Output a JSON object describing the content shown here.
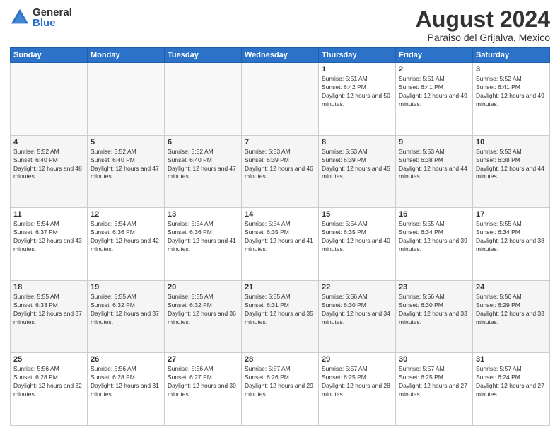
{
  "header": {
    "logo_general": "General",
    "logo_blue": "Blue",
    "month_year": "August 2024",
    "location": "Paraiso del Grijalva, Mexico"
  },
  "days_of_week": [
    "Sunday",
    "Monday",
    "Tuesday",
    "Wednesday",
    "Thursday",
    "Friday",
    "Saturday"
  ],
  "weeks": [
    [
      {
        "day": "",
        "sunrise": "",
        "sunset": "",
        "daylight": "",
        "empty": true
      },
      {
        "day": "",
        "sunrise": "",
        "sunset": "",
        "daylight": "",
        "empty": true
      },
      {
        "day": "",
        "sunrise": "",
        "sunset": "",
        "daylight": "",
        "empty": true
      },
      {
        "day": "",
        "sunrise": "",
        "sunset": "",
        "daylight": "",
        "empty": true
      },
      {
        "day": "1",
        "sunrise": "Sunrise: 5:51 AM",
        "sunset": "Sunset: 6:42 PM",
        "daylight": "Daylight: 12 hours and 50 minutes."
      },
      {
        "day": "2",
        "sunrise": "Sunrise: 5:51 AM",
        "sunset": "Sunset: 6:41 PM",
        "daylight": "Daylight: 12 hours and 49 minutes."
      },
      {
        "day": "3",
        "sunrise": "Sunrise: 5:52 AM",
        "sunset": "Sunset: 6:41 PM",
        "daylight": "Daylight: 12 hours and 49 minutes."
      }
    ],
    [
      {
        "day": "4",
        "sunrise": "Sunrise: 5:52 AM",
        "sunset": "Sunset: 6:40 PM",
        "daylight": "Daylight: 12 hours and 48 minutes."
      },
      {
        "day": "5",
        "sunrise": "Sunrise: 5:52 AM",
        "sunset": "Sunset: 6:40 PM",
        "daylight": "Daylight: 12 hours and 47 minutes."
      },
      {
        "day": "6",
        "sunrise": "Sunrise: 5:52 AM",
        "sunset": "Sunset: 6:40 PM",
        "daylight": "Daylight: 12 hours and 47 minutes."
      },
      {
        "day": "7",
        "sunrise": "Sunrise: 5:53 AM",
        "sunset": "Sunset: 6:39 PM",
        "daylight": "Daylight: 12 hours and 46 minutes."
      },
      {
        "day": "8",
        "sunrise": "Sunrise: 5:53 AM",
        "sunset": "Sunset: 6:39 PM",
        "daylight": "Daylight: 12 hours and 45 minutes."
      },
      {
        "day": "9",
        "sunrise": "Sunrise: 5:53 AM",
        "sunset": "Sunset: 6:38 PM",
        "daylight": "Daylight: 12 hours and 44 minutes."
      },
      {
        "day": "10",
        "sunrise": "Sunrise: 5:53 AM",
        "sunset": "Sunset: 6:38 PM",
        "daylight": "Daylight: 12 hours and 44 minutes."
      }
    ],
    [
      {
        "day": "11",
        "sunrise": "Sunrise: 5:54 AM",
        "sunset": "Sunset: 6:37 PM",
        "daylight": "Daylight: 12 hours and 43 minutes."
      },
      {
        "day": "12",
        "sunrise": "Sunrise: 5:54 AM",
        "sunset": "Sunset: 6:36 PM",
        "daylight": "Daylight: 12 hours and 42 minutes."
      },
      {
        "day": "13",
        "sunrise": "Sunrise: 5:54 AM",
        "sunset": "Sunset: 6:36 PM",
        "daylight": "Daylight: 12 hours and 41 minutes."
      },
      {
        "day": "14",
        "sunrise": "Sunrise: 5:54 AM",
        "sunset": "Sunset: 6:35 PM",
        "daylight": "Daylight: 12 hours and 41 minutes."
      },
      {
        "day": "15",
        "sunrise": "Sunrise: 5:54 AM",
        "sunset": "Sunset: 6:35 PM",
        "daylight": "Daylight: 12 hours and 40 minutes."
      },
      {
        "day": "16",
        "sunrise": "Sunrise: 5:55 AM",
        "sunset": "Sunset: 6:34 PM",
        "daylight": "Daylight: 12 hours and 39 minutes."
      },
      {
        "day": "17",
        "sunrise": "Sunrise: 5:55 AM",
        "sunset": "Sunset: 6:34 PM",
        "daylight": "Daylight: 12 hours and 38 minutes."
      }
    ],
    [
      {
        "day": "18",
        "sunrise": "Sunrise: 5:55 AM",
        "sunset": "Sunset: 6:33 PM",
        "daylight": "Daylight: 12 hours and 37 minutes."
      },
      {
        "day": "19",
        "sunrise": "Sunrise: 5:55 AM",
        "sunset": "Sunset: 6:32 PM",
        "daylight": "Daylight: 12 hours and 37 minutes."
      },
      {
        "day": "20",
        "sunrise": "Sunrise: 5:55 AM",
        "sunset": "Sunset: 6:32 PM",
        "daylight": "Daylight: 12 hours and 36 minutes."
      },
      {
        "day": "21",
        "sunrise": "Sunrise: 5:55 AM",
        "sunset": "Sunset: 6:31 PM",
        "daylight": "Daylight: 12 hours and 35 minutes."
      },
      {
        "day": "22",
        "sunrise": "Sunrise: 5:56 AM",
        "sunset": "Sunset: 6:30 PM",
        "daylight": "Daylight: 12 hours and 34 minutes."
      },
      {
        "day": "23",
        "sunrise": "Sunrise: 5:56 AM",
        "sunset": "Sunset: 6:30 PM",
        "daylight": "Daylight: 12 hours and 33 minutes."
      },
      {
        "day": "24",
        "sunrise": "Sunrise: 5:56 AM",
        "sunset": "Sunset: 6:29 PM",
        "daylight": "Daylight: 12 hours and 33 minutes."
      }
    ],
    [
      {
        "day": "25",
        "sunrise": "Sunrise: 5:56 AM",
        "sunset": "Sunset: 6:28 PM",
        "daylight": "Daylight: 12 hours and 32 minutes."
      },
      {
        "day": "26",
        "sunrise": "Sunrise: 5:56 AM",
        "sunset": "Sunset: 6:28 PM",
        "daylight": "Daylight: 12 hours and 31 minutes."
      },
      {
        "day": "27",
        "sunrise": "Sunrise: 5:56 AM",
        "sunset": "Sunset: 6:27 PM",
        "daylight": "Daylight: 12 hours and 30 minutes."
      },
      {
        "day": "28",
        "sunrise": "Sunrise: 5:57 AM",
        "sunset": "Sunset: 6:26 PM",
        "daylight": "Daylight: 12 hours and 29 minutes."
      },
      {
        "day": "29",
        "sunrise": "Sunrise: 5:57 AM",
        "sunset": "Sunset: 6:25 PM",
        "daylight": "Daylight: 12 hours and 28 minutes."
      },
      {
        "day": "30",
        "sunrise": "Sunrise: 5:57 AM",
        "sunset": "Sunset: 6:25 PM",
        "daylight": "Daylight: 12 hours and 27 minutes."
      },
      {
        "day": "31",
        "sunrise": "Sunrise: 5:57 AM",
        "sunset": "Sunset: 6:24 PM",
        "daylight": "Daylight: 12 hours and 27 minutes."
      }
    ]
  ]
}
